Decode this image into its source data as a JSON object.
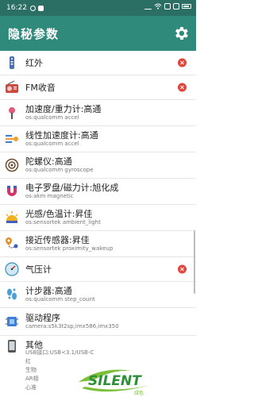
{
  "status_bar": {
    "time": "16:22"
  },
  "app_bar": {
    "title": "隐秘参数",
    "settings_icon": "gear-icon"
  },
  "sensors": [
    {
      "name": "红外",
      "sub": "",
      "icon": "remote-icon",
      "disabled": true
    },
    {
      "name": "FM收音",
      "sub": "",
      "icon": "radio-icon",
      "disabled": true
    },
    {
      "name": "加速度/重力计:高通",
      "sub": "os:qualcomm accel",
      "icon": "accelerometer-icon",
      "disabled": false
    },
    {
      "name": "线性加速度计:高通",
      "sub": "os:qualcomm accel",
      "icon": "linear-accel-icon",
      "disabled": false
    },
    {
      "name": "陀螺仪:高通",
      "sub": "os:qualcomm gyroscope",
      "icon": "gyroscope-icon",
      "disabled": false
    },
    {
      "name": "电子罗盘/磁力计:旭化成",
      "sub": "os:akm magnetic",
      "icon": "magnet-icon",
      "disabled": false
    },
    {
      "name": "光感/色温计:昇佳",
      "sub": "os:sensortek ambient_light",
      "icon": "light-sensor-icon",
      "disabled": false
    },
    {
      "name": "接近传感器:昇佳",
      "sub": "os:sensortek proximity_wakeup",
      "icon": "proximity-icon",
      "disabled": false
    },
    {
      "name": "气压计",
      "sub": "",
      "icon": "barometer-icon",
      "disabled": true
    },
    {
      "name": "计步器:高通",
      "sub": "os:qualcomm step_count",
      "icon": "pedometer-icon",
      "disabled": false
    },
    {
      "name": "驱动程序",
      "sub": "camera:s5k3t2sp,imx586,imx350",
      "icon": "chip-icon",
      "disabled": false
    }
  ],
  "other": {
    "name": "其他",
    "icon": "phone-icon",
    "lines": [
      "USB接口:USB<3.1/USB-C",
      "红",
      "生物",
      "AR相",
      "心准"
    ]
  },
  "watermark": {
    "text": "SILENT",
    "sub": "绿色"
  },
  "colors": {
    "app_bar": "#2f8a7b",
    "status_bar": "#2b6f64",
    "disabled_badge": "#e2453c"
  }
}
